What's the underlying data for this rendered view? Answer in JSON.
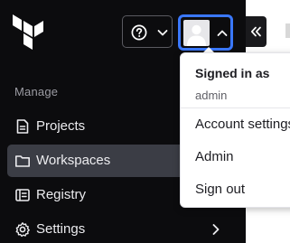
{
  "sidebar": {
    "section_label": "Manage",
    "items": [
      {
        "label": "Projects",
        "icon": "projects-icon",
        "active": false
      },
      {
        "label": "Workspaces",
        "icon": "folder-icon",
        "active": true
      },
      {
        "label": "Registry",
        "icon": "registry-icon",
        "active": false
      },
      {
        "label": "Settings",
        "icon": "gear-icon",
        "active": false
      }
    ]
  },
  "header": {
    "help_icon": "help-circle-icon",
    "help_chevron": "chevron-down-icon",
    "user_chevron": "chevron-up-icon",
    "collapse_icon": "double-chevron-left-icon"
  },
  "user_menu": {
    "heading": "Signed in as",
    "username": "admin",
    "items": [
      {
        "label": "Account settings"
      },
      {
        "label": "Admin"
      },
      {
        "label": "Sign out"
      }
    ]
  },
  "colors": {
    "sidebar_bg": "#0c0c0e",
    "active_item_bg": "#3b3d45",
    "focus_ring": "#3a78ff",
    "dropdown_bg": "#ffffff"
  }
}
